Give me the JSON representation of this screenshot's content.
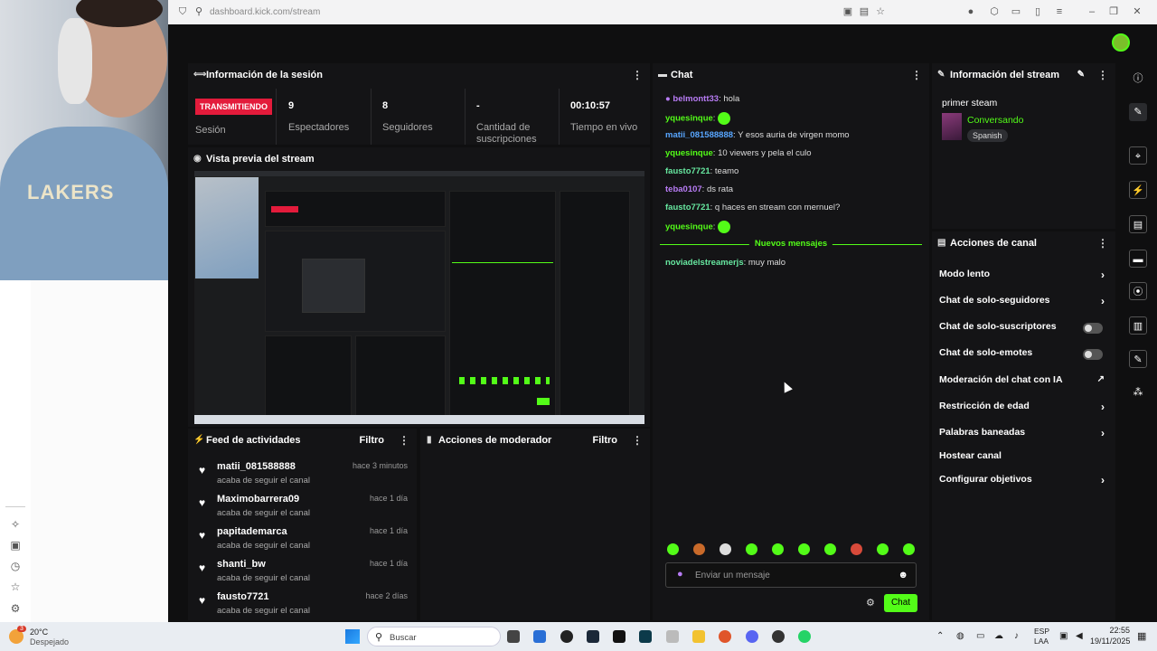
{
  "browser": {
    "url": "dashboard.kick.com/stream"
  },
  "session": {
    "title": "Información de la sesión",
    "live_badge": "TRANSMITIENDO",
    "session_label": "Sesión",
    "stats": [
      {
        "value": "9",
        "label": "Espectadores"
      },
      {
        "value": "8",
        "label": "Seguidores"
      },
      {
        "value": "-",
        "label": "Cantidad de suscripciones"
      },
      {
        "value": "00:10:57",
        "label": "Tiempo en vivo"
      }
    ]
  },
  "preview": {
    "title": "Vista previa del stream"
  },
  "activity": {
    "title": "Feed de actividades",
    "filter": "Filtro",
    "items": [
      {
        "name": "matii_081588888",
        "sub": "acaba de seguir el canal",
        "time": "hace 3 minutos"
      },
      {
        "name": "Maximobarrera09",
        "sub": "acaba de seguir el canal",
        "time": "hace 1 día"
      },
      {
        "name": "papitademarca",
        "sub": "acaba de seguir el canal",
        "time": "hace 1 día"
      },
      {
        "name": "shanti_bw",
        "sub": "acaba de seguir el canal",
        "time": "hace 1 día"
      },
      {
        "name": "fausto7721",
        "sub": "acaba de seguir el canal",
        "time": "hace 2 días"
      }
    ]
  },
  "moderator": {
    "title": "Acciones de moderador",
    "filter": "Filtro"
  },
  "chat": {
    "title": "Chat",
    "messages": [
      {
        "user": "belmontt33",
        "text": "hola"
      },
      {
        "user": "yquesinque",
        "text": ""
      },
      {
        "user": "matii_081588888",
        "text": "Y esos auria de virgen momo"
      },
      {
        "user": "yquesinque",
        "text": "10 viewers y pela el culo"
      },
      {
        "user": "fausto7721",
        "text": "teamo"
      },
      {
        "user": "teba0107",
        "text": "ds rata"
      },
      {
        "user": "fausto7721",
        "text": "q haces en stream con mernuel?"
      },
      {
        "user": "yquesinque",
        "text": ""
      }
    ],
    "new_messages_label": "Nuevos mensajes",
    "new_message": {
      "user": "noviadelstreamerjs",
      "text": "muy malo"
    },
    "input_placeholder": "Enviar un mensaje",
    "send_label": "Chat"
  },
  "stream_info": {
    "title": "Información del stream",
    "stream_title": "primer steam",
    "category": "Conversando",
    "language": "Spanish"
  },
  "channel_actions": {
    "title": "Acciones de canal",
    "items": [
      {
        "label": "Modo lento",
        "kind": "arrow"
      },
      {
        "label": "Chat de solo-seguidores",
        "kind": "arrow"
      },
      {
        "label": "Chat de solo-suscriptores",
        "kind": "toggle"
      },
      {
        "label": "Chat de solo-emotes",
        "kind": "toggle"
      },
      {
        "label": "Moderación del chat con IA",
        "kind": "external"
      },
      {
        "label": "Restricción de edad",
        "kind": "arrow"
      },
      {
        "label": "Palabras baneadas",
        "kind": "arrow"
      },
      {
        "label": "Hostear canal",
        "kind": "none"
      },
      {
        "label": "Configurar objetivos",
        "kind": "arrow"
      }
    ]
  },
  "taskbar": {
    "weather_temp": "20°C",
    "weather_desc": "Despejado",
    "search": "Buscar",
    "lang": "ESP",
    "lang2": "LAA",
    "time": "22:55",
    "date": "19/11/2025",
    "weather_badge": "3"
  },
  "colors": {
    "accent": "#53fc18",
    "live": "#e31b3b"
  }
}
